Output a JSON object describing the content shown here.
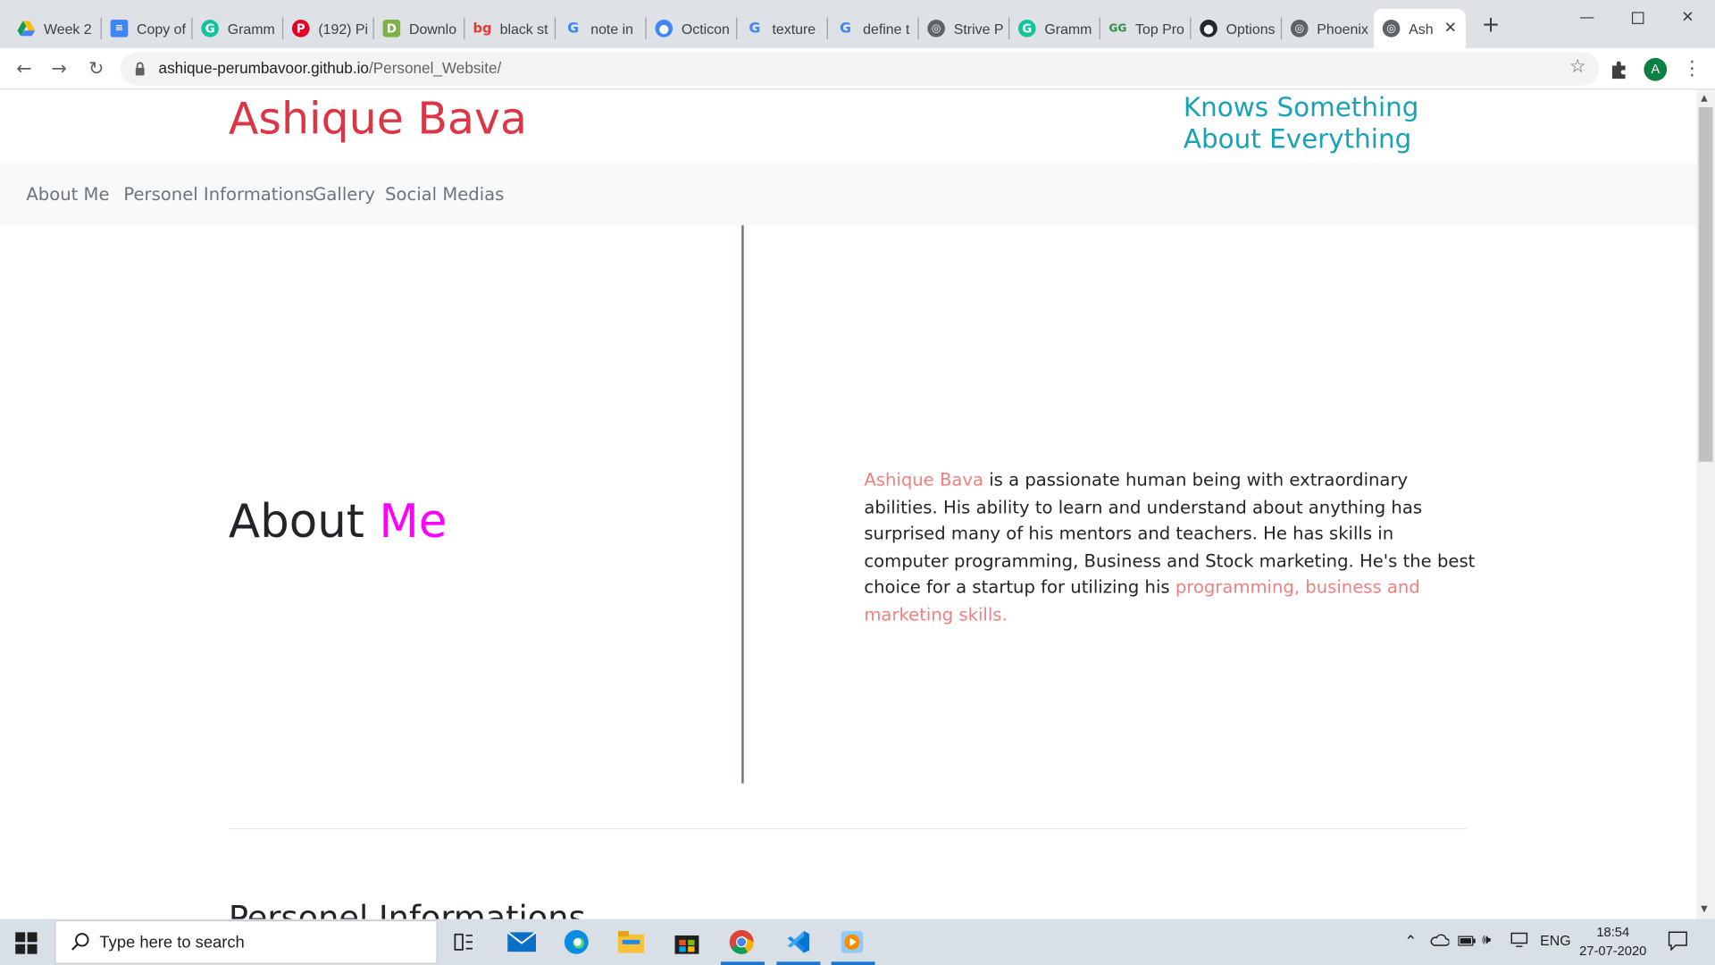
{
  "browser": {
    "tabs": [
      {
        "title": "Week 2",
        "icon": "google-drive-icon"
      },
      {
        "title": "Copy of",
        "icon": "google-docs-icon"
      },
      {
        "title": "Gramm",
        "icon": "grammarly-icon"
      },
      {
        "title": "(192) Pi",
        "icon": "pinterest-icon"
      },
      {
        "title": "Downlo",
        "icon": "download-site-icon"
      },
      {
        "title": "black st",
        "icon": "bg-site-icon"
      },
      {
        "title": "note in",
        "icon": "google-icon"
      },
      {
        "title": "Octicon",
        "icon": "github-icon"
      },
      {
        "title": "texture",
        "icon": "google-icon"
      },
      {
        "title": "define t",
        "icon": "google-icon"
      },
      {
        "title": "Strive P",
        "icon": "globe-icon"
      },
      {
        "title": "Gramm",
        "icon": "grammarly-icon"
      },
      {
        "title": "Top Pro",
        "icon": "geeksforgeeks-icon"
      },
      {
        "title": "Options",
        "icon": "github-icon"
      },
      {
        "title": "Phoenix",
        "icon": "globe-icon"
      },
      {
        "title": "Ash",
        "icon": "globe-icon"
      }
    ],
    "url_host": "ashique-perumbavoor.github.io",
    "url_path": "/Personel_Website/",
    "avatar_letter": "A"
  },
  "site": {
    "brand": "Ashique Bava",
    "tagline_line1": "Knows Something",
    "tagline_line2": "About Everything",
    "nav": [
      "About Me",
      "Personel Informations",
      "Gallery",
      "Social Medias"
    ],
    "about_heading_part1": "About",
    "about_heading_part2": "Me",
    "about_name": "Ashique Bava",
    "about_text": " is a passionate human being with extraordinary abilities. His ability to learn and understand about anything has surprised many of his mentors and teachers. He has skills in computer programming, Business and Stock marketing. He's the best choice for a startup for utilizing his ",
    "about_skills": "programming, business and marketing skills.",
    "next_heading": "Personel Informations"
  },
  "colors": {
    "brand": "#dc3545",
    "tagline": "#17a2b8",
    "me_accent": "#ff00ff",
    "highlight": "#f08080"
  },
  "taskbar": {
    "search_placeholder": "Type here to search",
    "language": "ENG",
    "time": "18:54",
    "date": "27-07-2020",
    "pinned": [
      "task-view-icon",
      "mail-icon",
      "edge-icon",
      "file-explorer-icon",
      "store-icon",
      "chrome-icon",
      "vscode-icon",
      "media-player-icon"
    ]
  }
}
